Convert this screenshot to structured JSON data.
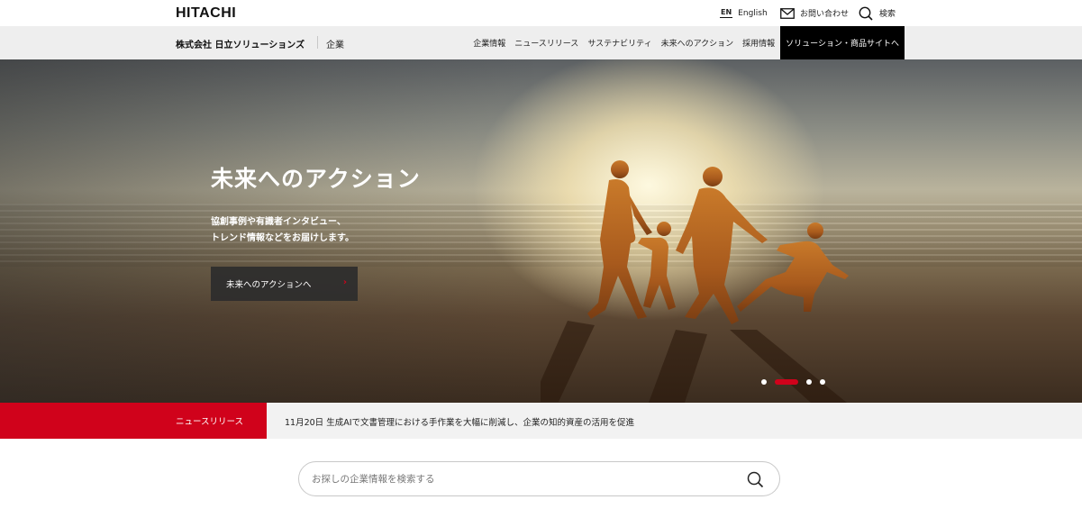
{
  "header": {
    "logo": "HITACHI",
    "lang_badge": "EN",
    "lang_label": "English",
    "contact_label": "お問い合わせ",
    "search_label": "検索"
  },
  "nav": {
    "company_name": "株式会社 日立ソリューションズ",
    "section": "企業",
    "links": [
      "企業情報",
      "ニュースリリース",
      "サステナビリティ",
      "未来へのアクション",
      "採用情報"
    ],
    "cta": "ソリューション・商品サイトへ"
  },
  "hero": {
    "title": "未来へのアクション",
    "subtitle_line1": "協創事例や有識者インタビュー、",
    "subtitle_line2": "トレンド情報などをお届けします。",
    "button_label": "未来へのアクションへ",
    "button_arrow": "›",
    "carousel_active_index": 1,
    "carousel_count": 4
  },
  "news": {
    "label": "ニュースリリース",
    "headline": "11月20日 生成AIで文書管理における手作業を大幅に削減し、企業の知的資産の活用を促進"
  },
  "search": {
    "placeholder": "お探しの企業情報を検索する"
  },
  "colors": {
    "accent_red": "#d0021b",
    "nav_bg": "#eeeeee",
    "cta_bg": "#000000"
  }
}
